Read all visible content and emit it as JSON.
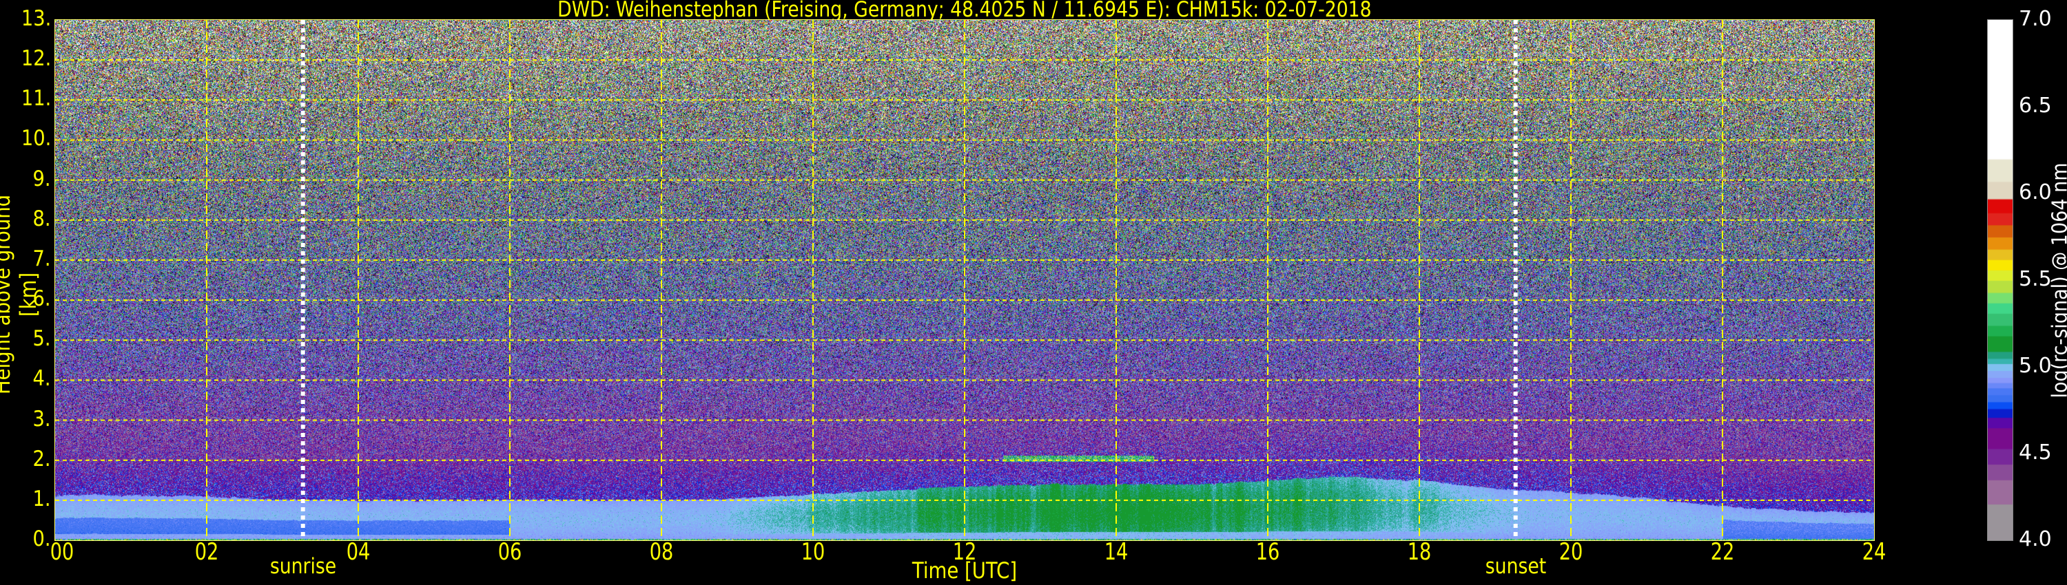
{
  "chart_data": {
    "type": "heatmap",
    "title": "DWD: Weihenstephan (Freising, Germany; 48.4025 N / 11.6945 E):    CHM15k: 02-07-2018",
    "xlabel": "Time [UTC]",
    "ylabel": "Height above ground [km]",
    "xlim": [
      0,
      24
    ],
    "ylim": [
      0,
      13
    ],
    "x_ticks": [
      "00",
      "02",
      "04",
      "06",
      "08",
      "10",
      "12",
      "14",
      "16",
      "18",
      "20",
      "22",
      "24"
    ],
    "y_ticks": [
      "0.",
      "1.",
      "2.",
      "3.",
      "4.",
      "5.",
      "6.",
      "7.",
      "8.",
      "9.",
      "10.",
      "11.",
      "12.",
      "13."
    ],
    "grid": true,
    "grid_color": "#ffff00",
    "annotations": [
      {
        "label": "sunrise",
        "time": 3.27
      },
      {
        "label": "sunset",
        "time": 19.27
      }
    ],
    "aerosol_layer_top_km": {
      "time": [
        0,
        1,
        2,
        3,
        4,
        5,
        6,
        7,
        8,
        9,
        10,
        11,
        12,
        13,
        14,
        15,
        16,
        17,
        18,
        19,
        20,
        21,
        22,
        23,
        24
      ],
      "height": [
        1.15,
        1.12,
        1.1,
        1.02,
        1.0,
        1.0,
        1.0,
        1.0,
        1.0,
        1.05,
        1.15,
        1.25,
        1.35,
        1.4,
        1.4,
        1.4,
        1.5,
        1.6,
        1.5,
        1.3,
        1.2,
        1.05,
        0.85,
        0.75,
        0.7
      ]
    },
    "colorbar": {
      "label": "log(rc-signal) @ 1064 nm",
      "range": [
        4.0,
        7.0
      ],
      "ticks": [
        "4.0",
        "4.5",
        "5.0",
        "5.5",
        "6.0",
        "6.5",
        "7.0"
      ],
      "levels": [
        {
          "from": 4.0,
          "color": "#9a949a"
        },
        {
          "from": 4.21,
          "color": "#9c6c9c"
        },
        {
          "from": 4.35,
          "color": "#8a4c98"
        },
        {
          "from": 4.44,
          "color": "#78289a"
        },
        {
          "from": 4.53,
          "color": "#780c8c"
        },
        {
          "from": 4.65,
          "color": "#5a08a8"
        },
        {
          "from": 4.71,
          "color": "#0a1ecc"
        },
        {
          "from": 4.76,
          "color": "#0a50f4"
        },
        {
          "from": 4.8,
          "color": "#3a70f0"
        },
        {
          "from": 4.84,
          "color": "#4a78f4"
        },
        {
          "from": 4.88,
          "color": "#6a88f8"
        },
        {
          "from": 4.91,
          "color": "#8898fa"
        },
        {
          "from": 4.94,
          "color": "#88a8f8"
        },
        {
          "from": 4.98,
          "color": "#80c0f0"
        },
        {
          "from": 5.02,
          "color": "#38b4b0"
        },
        {
          "from": 5.05,
          "color": "#22a080"
        },
        {
          "from": 5.09,
          "color": "#169a30"
        },
        {
          "from": 5.18,
          "color": "#1eb050"
        },
        {
          "from": 5.24,
          "color": "#36c072"
        },
        {
          "from": 5.31,
          "color": "#40d688"
        },
        {
          "from": 5.37,
          "color": "#78e070"
        },
        {
          "from": 5.43,
          "color": "#b8e040"
        },
        {
          "from": 5.5,
          "color": "#dcee2c"
        },
        {
          "from": 5.56,
          "color": "#fae800"
        },
        {
          "from": 5.62,
          "color": "#e8c020"
        },
        {
          "from": 5.68,
          "color": "#e8900c"
        },
        {
          "from": 5.75,
          "color": "#d8600a"
        },
        {
          "from": 5.82,
          "color": "#e0241e"
        },
        {
          "from": 5.89,
          "color": "#e00808"
        },
        {
          "from": 5.97,
          "color": "#e0d6c0"
        },
        {
          "from": 6.07,
          "color": "#e8e6d0"
        },
        {
          "from": 6.2,
          "color": "#ffffff"
        }
      ]
    }
  }
}
